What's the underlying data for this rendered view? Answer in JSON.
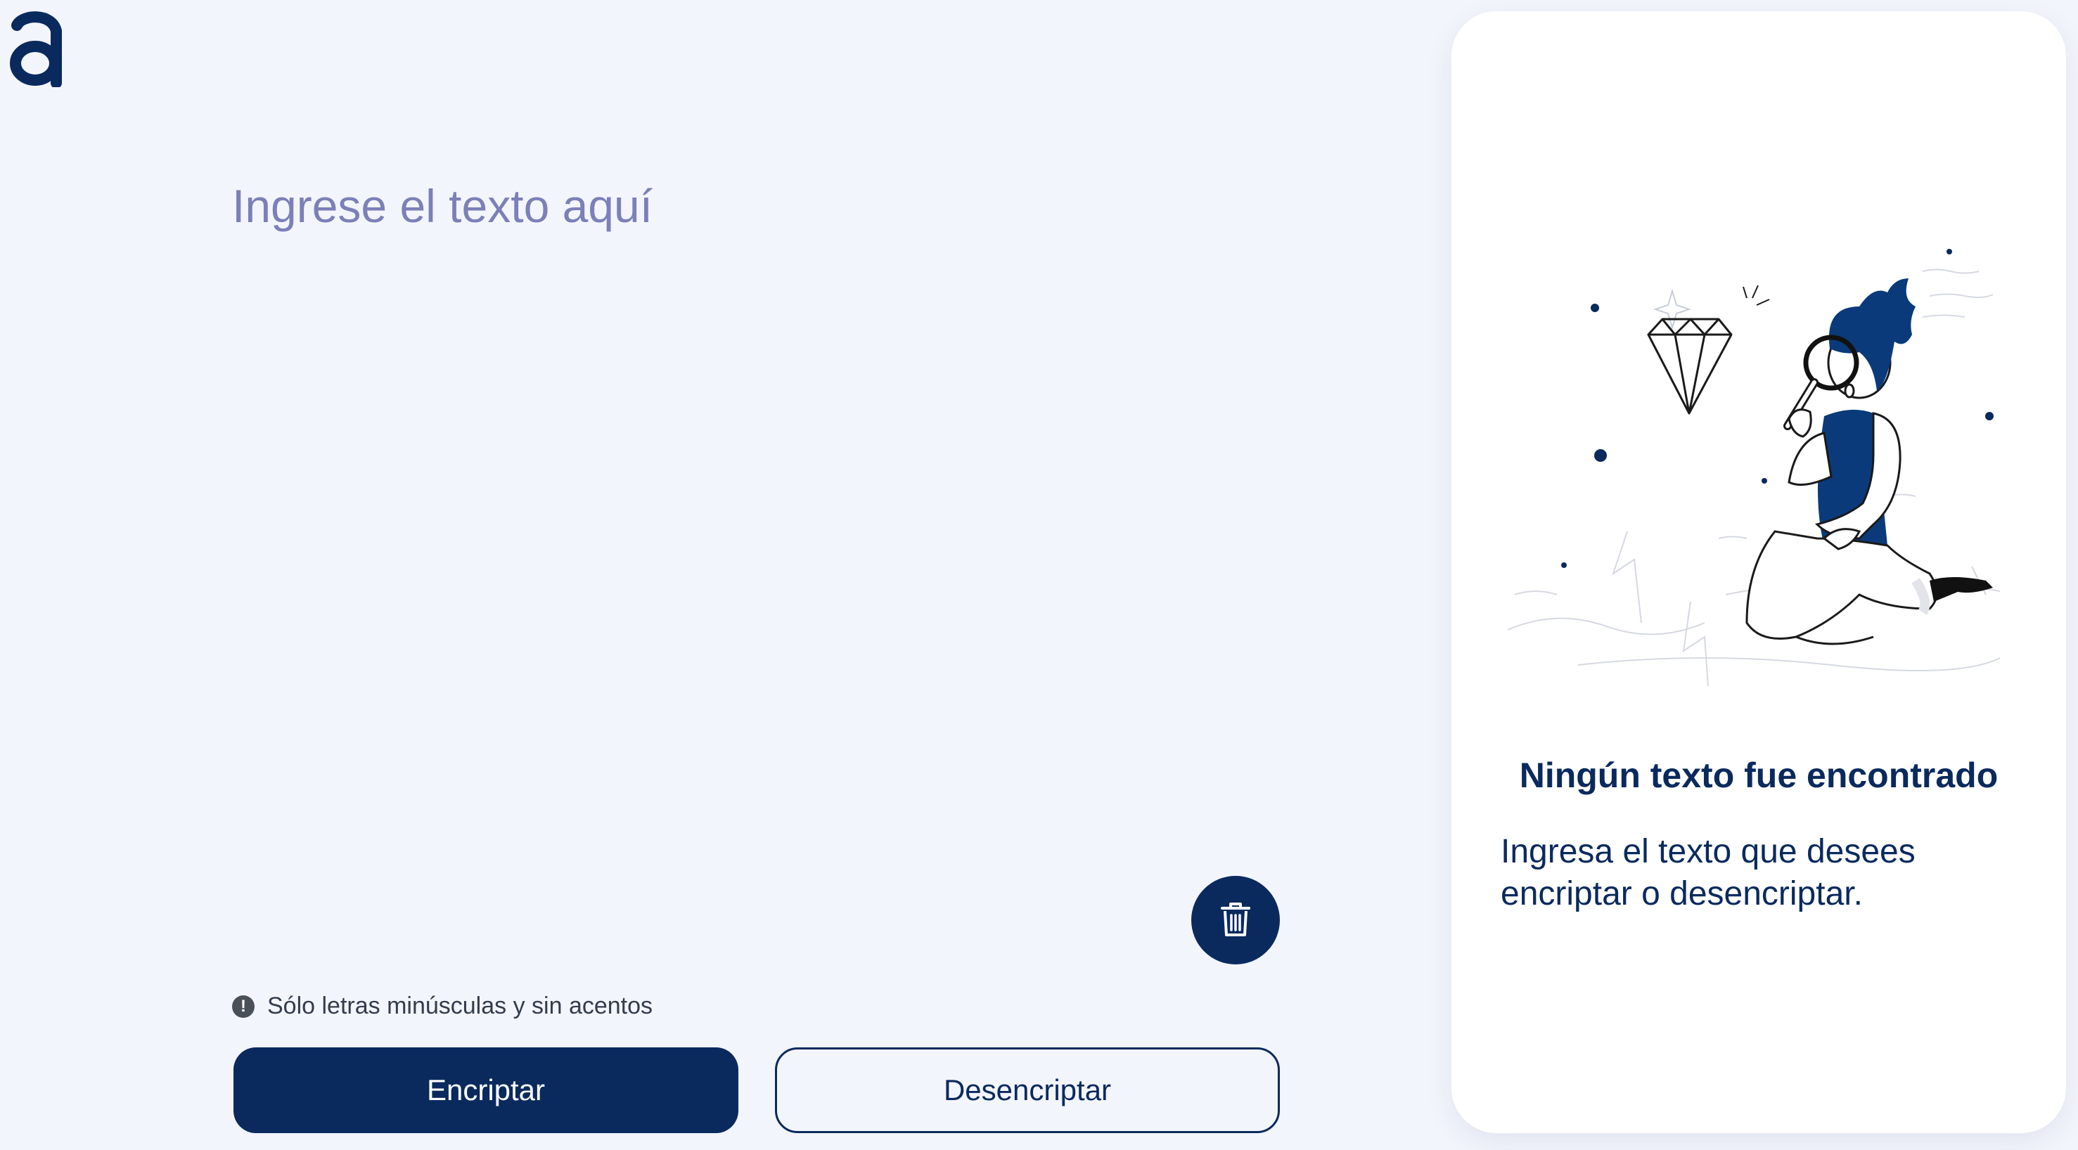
{
  "app": {
    "logo_icon": "alura-a-logo-icon",
    "accent_color": "#0a2a5e",
    "background_color": "#f3f5fc"
  },
  "editor": {
    "placeholder": "Ingrese el texto aquí",
    "value": "",
    "clear_icon": "trash-icon"
  },
  "hint": {
    "icon": "exclamation-circle-icon",
    "text": "Sólo letras minúsculas y sin acentos"
  },
  "actions": {
    "encrypt_label": "Encriptar",
    "decrypt_label": "Desencriptar"
  },
  "result": {
    "illustration_icon": "person-with-magnifier-illustration",
    "title": "Ningún texto fue encontrado",
    "description": "Ingresa el texto que desees encriptar o desencriptar."
  }
}
